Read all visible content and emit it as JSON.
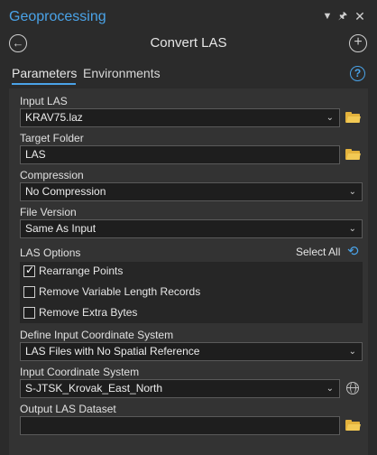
{
  "window": {
    "title": "Geoprocessing"
  },
  "header": {
    "tool_title": "Convert LAS"
  },
  "tabs": [
    {
      "label": "Parameters",
      "active": true
    },
    {
      "label": "Environments",
      "active": false
    }
  ],
  "colors": {
    "accent": "#4aa3e8",
    "folder": "#e3b23c"
  },
  "icons": {
    "back": "back-arrow-icon",
    "add": "add-icon",
    "help": "help-icon",
    "folder": "folder-icon",
    "globe": "globe-icon",
    "refresh": "refresh-icon"
  },
  "fields": {
    "input_las": {
      "label": "Input LAS",
      "value": "KRAV75.laz"
    },
    "target_folder": {
      "label": "Target Folder",
      "value": "LAS"
    },
    "compression": {
      "label": "Compression",
      "value": "No Compression"
    },
    "file_version": {
      "label": "File Version",
      "value": "Same As Input"
    },
    "define_input_cs": {
      "label": "Define Input Coordinate System",
      "value": "LAS Files with No Spatial Reference"
    },
    "input_cs": {
      "label": "Input Coordinate System",
      "value": "S-JTSK_Krovak_East_North"
    },
    "output_dataset": {
      "label": "Output LAS Dataset",
      "value": ""
    }
  },
  "las_options": {
    "label": "LAS Options",
    "select_all": "Select All",
    "items": [
      {
        "label": "Rearrange Points",
        "checked": true
      },
      {
        "label": "Remove Variable Length Records",
        "checked": false
      },
      {
        "label": "Remove Extra Bytes",
        "checked": false
      }
    ]
  }
}
